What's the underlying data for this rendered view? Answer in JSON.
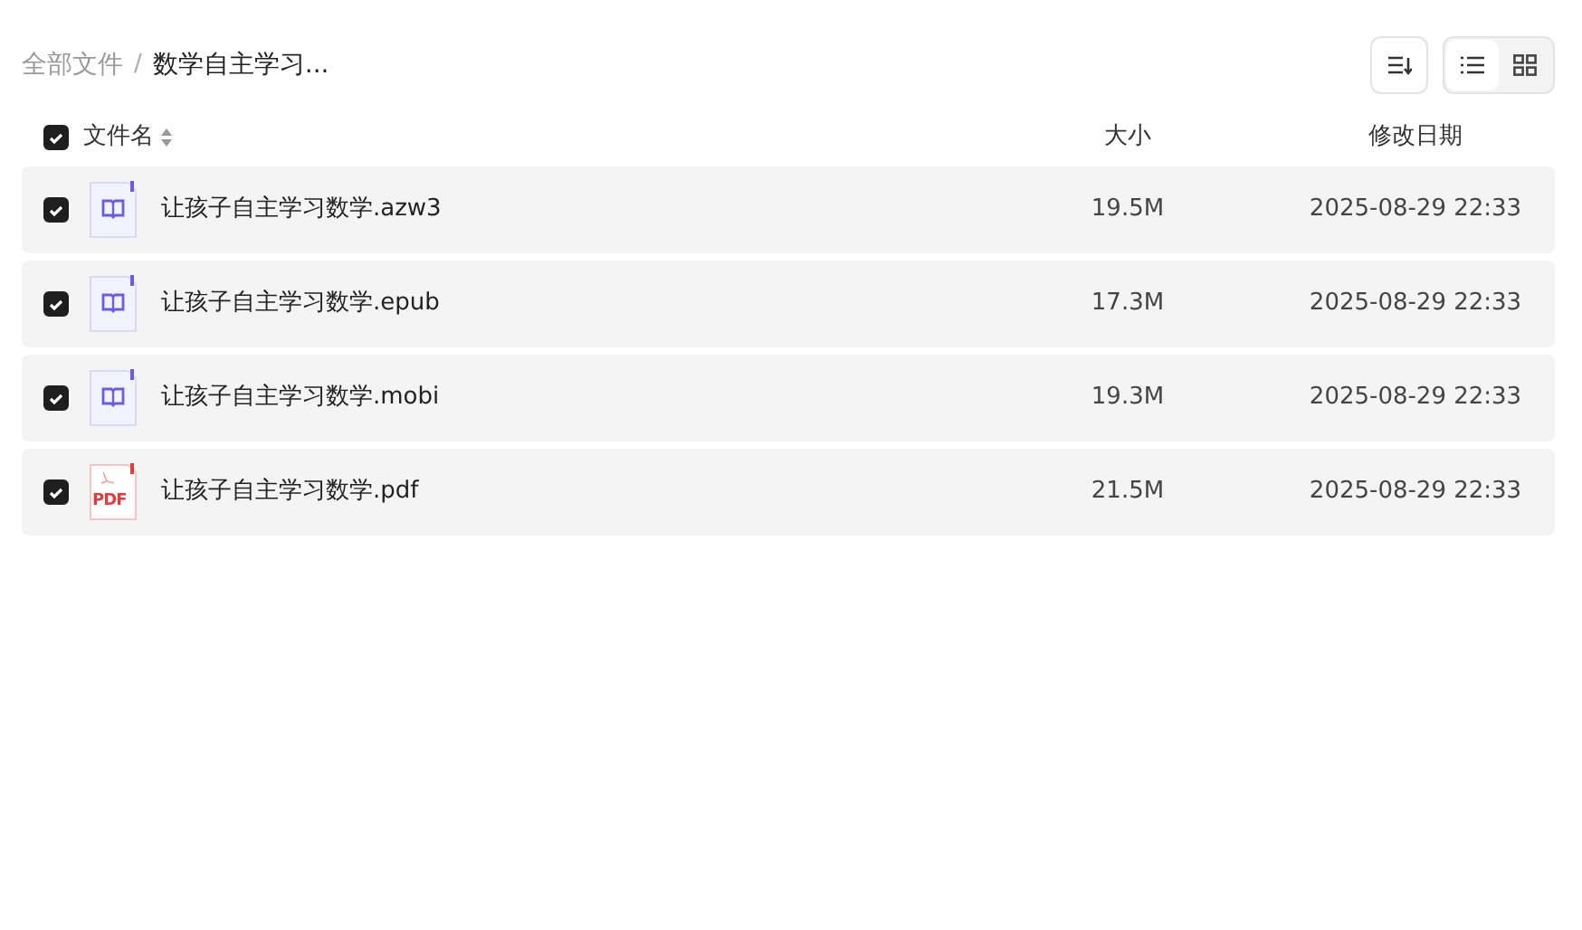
{
  "breadcrumb_separator": "/",
  "breadcrumb": [
    {
      "label": "全部文件",
      "current": false
    },
    {
      "label": "数学自主学习...",
      "current": true
    }
  ],
  "view_modes": [
    {
      "kind": "list",
      "selected": true
    },
    {
      "kind": "grid",
      "selected": false
    }
  ],
  "header": {
    "select_all_checked": true,
    "columns": [
      "文件名",
      "大小",
      "修改日期"
    ]
  },
  "files": [
    {
      "name": "让孩子自主学习数学.azw3",
      "kind": "ebook",
      "size": "19.5M",
      "modified": "2025-08-29 22:33",
      "checked": true
    },
    {
      "name": "让孩子自主学习数学.epub",
      "kind": "ebook",
      "size": "17.3M",
      "modified": "2025-08-29 22:33",
      "checked": true
    },
    {
      "name": "让孩子自主学习数学.mobi",
      "kind": "ebook",
      "size": "19.3M",
      "modified": "2025-08-29 22:33",
      "checked": true
    },
    {
      "name": "让孩子自主学习数学.pdf",
      "kind": "pdf",
      "icon_text": "PDF",
      "size": "21.5M",
      "modified": "2025-08-29 22:33",
      "checked": true
    }
  ]
}
